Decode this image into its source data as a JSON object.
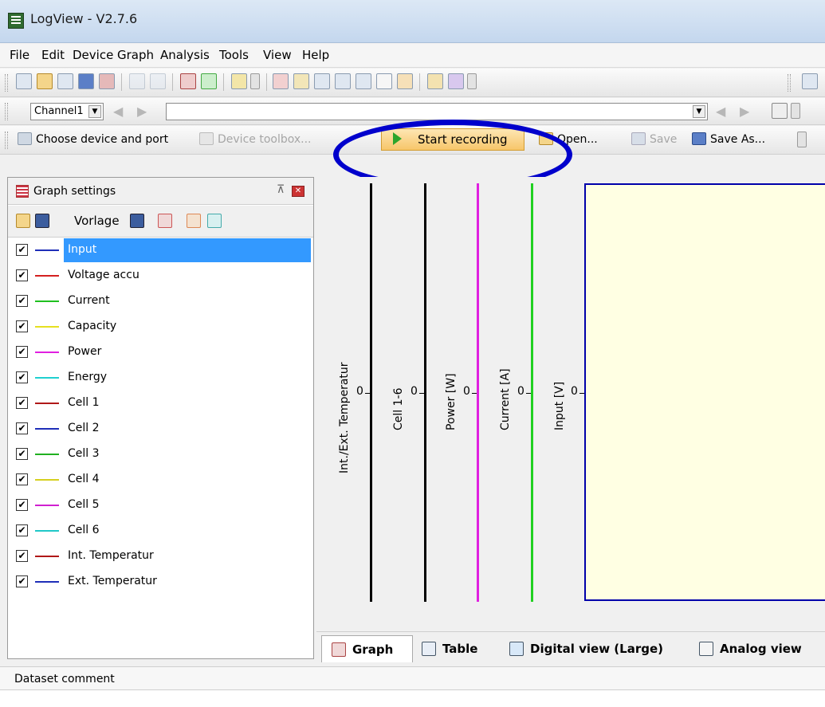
{
  "window": {
    "title": "LogView - V2.7.6"
  },
  "menu": [
    "File",
    "Edit",
    "Device",
    "Graph",
    "Analysis",
    "Tools",
    "View",
    "Help"
  ],
  "channel_bar": {
    "channel": "Channel1"
  },
  "command_bar": {
    "choose_device": "Choose device and port",
    "device_toolbox": "Device toolbox...",
    "start_recording": "Start recording",
    "open": "Open...",
    "save": "Save",
    "save_as": "Save As..."
  },
  "graph_settings": {
    "title": "Graph settings",
    "vorlage": "Vorlage",
    "series": [
      {
        "name": "Input",
        "color": "#1f2fb8",
        "checked": true,
        "selected": true
      },
      {
        "name": "Voltage accu",
        "color": "#d42020",
        "checked": true
      },
      {
        "name": "Current",
        "color": "#20c020",
        "checked": true
      },
      {
        "name": "Capacity",
        "color": "#e6e020",
        "checked": true
      },
      {
        "name": "Power",
        "color": "#e020e0",
        "checked": true
      },
      {
        "name": "Energy",
        "color": "#20d0d0",
        "checked": true
      },
      {
        "name": "Cell 1",
        "color": "#b01818",
        "checked": true
      },
      {
        "name": "Cell 2",
        "color": "#1f2fb8",
        "checked": true
      },
      {
        "name": "Cell 3",
        "color": "#20b020",
        "checked": true
      },
      {
        "name": "Cell 4",
        "color": "#d6d020",
        "checked": true
      },
      {
        "name": "Cell 5",
        "color": "#d020d0",
        "checked": true
      },
      {
        "name": "Cell 6",
        "color": "#20c8c8",
        "checked": true
      },
      {
        "name": "Int. Temperatur",
        "color": "#b01818",
        "checked": true
      },
      {
        "name": "Ext. Temperatur",
        "color": "#1f2fb8",
        "checked": true
      }
    ]
  },
  "graph": {
    "axes": [
      {
        "label": "Int./Ext. Temperatur",
        "zero": "0",
        "color": "#000000"
      },
      {
        "label": "Cell 1-6",
        "zero": "0",
        "color": "#000000"
      },
      {
        "label": "Power [W]",
        "zero": "0",
        "color": "#e020e0"
      },
      {
        "label": "Current [A]",
        "zero": "0",
        "color": "#20d020"
      },
      {
        "label": "Input [V]",
        "zero": "0",
        "color": "#0000aa"
      }
    ]
  },
  "tabs": [
    "Graph",
    "Table",
    "Digital view (Large)",
    "Analog view"
  ],
  "footer": {
    "comment_label": "Dataset comment"
  }
}
